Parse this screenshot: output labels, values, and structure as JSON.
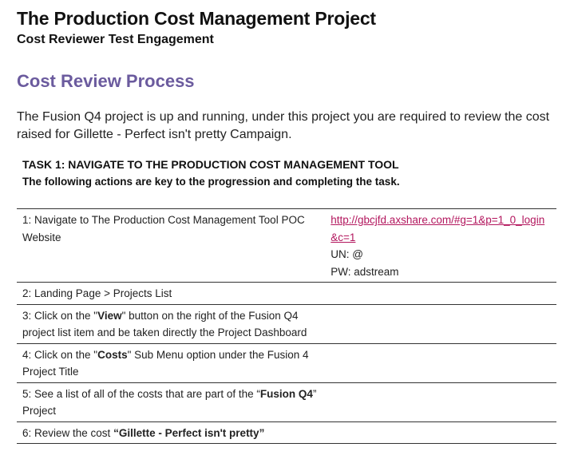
{
  "document": {
    "title": "The Production Cost Management Project",
    "subtitle": "Cost Reviewer Test Engagement"
  },
  "section": {
    "heading": "Cost Review Process",
    "intro": "The Fusion Q4 project is up and running, under this project you are required to review the cost raised for Gillette - Perfect isn't pretty Campaign."
  },
  "task": {
    "title": "TASK 1: NAVIGATE TO THE PRODUCTION COST MANAGEMENT TOOL",
    "subtitle": "The following actions are key to the progression and completing the task."
  },
  "steps": [
    {
      "text": "1: Navigate to The Production Cost Management Tool POC Website",
      "link": "http://gbcjfd.axshare.com/#g=1&p=1_0_login&c=1",
      "un": "UN: @",
      "pw": "PW: adstream"
    },
    {
      "text": "2: Landing Page > Projects List"
    },
    {
      "pre": "3: Click on the \"",
      "bold": "View",
      "post": "\" button on the right of the Fusion Q4 project list item and be taken directly the Project Dashboard"
    },
    {
      "pre": "4: Click on the \"",
      "bold": "Costs",
      "post": "\" Sub Menu option under the Fusion 4 Project Title"
    },
    {
      "pre": "5: See a list of all of the costs that are part of the “",
      "bold": "Fusion Q4",
      "post": "” Project"
    },
    {
      "pre": "6: Review the cost ",
      "bold": "“Gillette - Perfect isn't pretty”",
      "post": ""
    }
  ],
  "colors": {
    "heading": "#6b5b9e",
    "link": "#b3175e"
  }
}
